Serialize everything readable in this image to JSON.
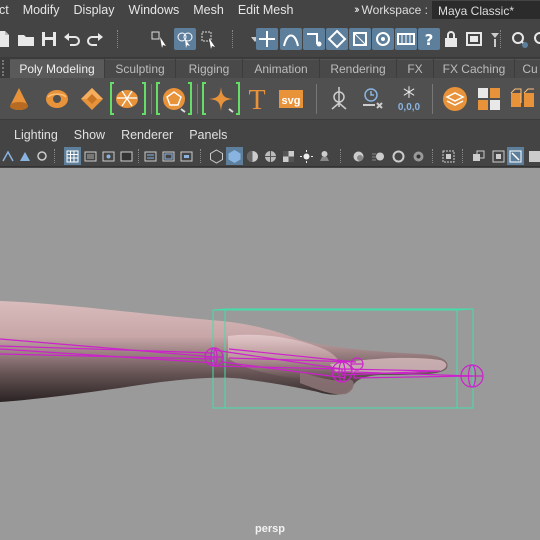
{
  "menubar": {
    "items": [
      "ect",
      "Modify",
      "Display",
      "Windows",
      "Mesh",
      "Edit Mesh"
    ],
    "workspace_label": "Workspace :",
    "workspace_value": "Maya Classic*"
  },
  "shelf_tabs": {
    "tabs": [
      "Poly Modeling",
      "Sculpting",
      "Rigging",
      "Animation",
      "Rendering",
      "FX",
      "FX Caching",
      "Cu"
    ],
    "active": "Poly Modeling"
  },
  "shelf": {
    "text_tool_glyph": "T",
    "svg_tool_label": "svg",
    "bake_readout": "0,0,0"
  },
  "panel_menus": [
    "Lighting",
    "Show",
    "Renderer",
    "Panels"
  ],
  "viewport": {
    "camera": "persp",
    "background_color": "#9a9a9a",
    "joint_color": "#cc22cc",
    "bbox_color": "#44ddaa"
  },
  "colors": {
    "ui_bg": "#444444",
    "active_highlight": "#5d7f9c",
    "shelf_accent_orange": "#e8923a",
    "bracket_green": "#66dd66"
  },
  "icons": {
    "status_line": [
      "new-scene-icon",
      "open-scene-icon",
      "save-scene-icon",
      "undo-icon",
      "redo-icon",
      "select-hierarchy-icon",
      "select-object-icon",
      "select-component-icon",
      "snap-grid-icon",
      "snap-curve-icon",
      "snap-point-icon",
      "snap-view-plane-icon",
      "snap-surface-icon",
      "make-live-icon",
      "history-icon",
      "render-frame-icon",
      "help-icon",
      "lock-icon",
      "camera-icon",
      "search-icon"
    ],
    "shelf": [
      "cone-icon",
      "torus-icon",
      "cube-icon",
      "cylinder-icon",
      "soccer-ball-icon",
      "sparkle-icon",
      "text-tool-icon",
      "svg-tool-icon",
      "target-icon",
      "clock-icon",
      "snowflake-icon",
      "layers-icon",
      "grid-cube-icon",
      "sphere-cubes-icon"
    ]
  }
}
